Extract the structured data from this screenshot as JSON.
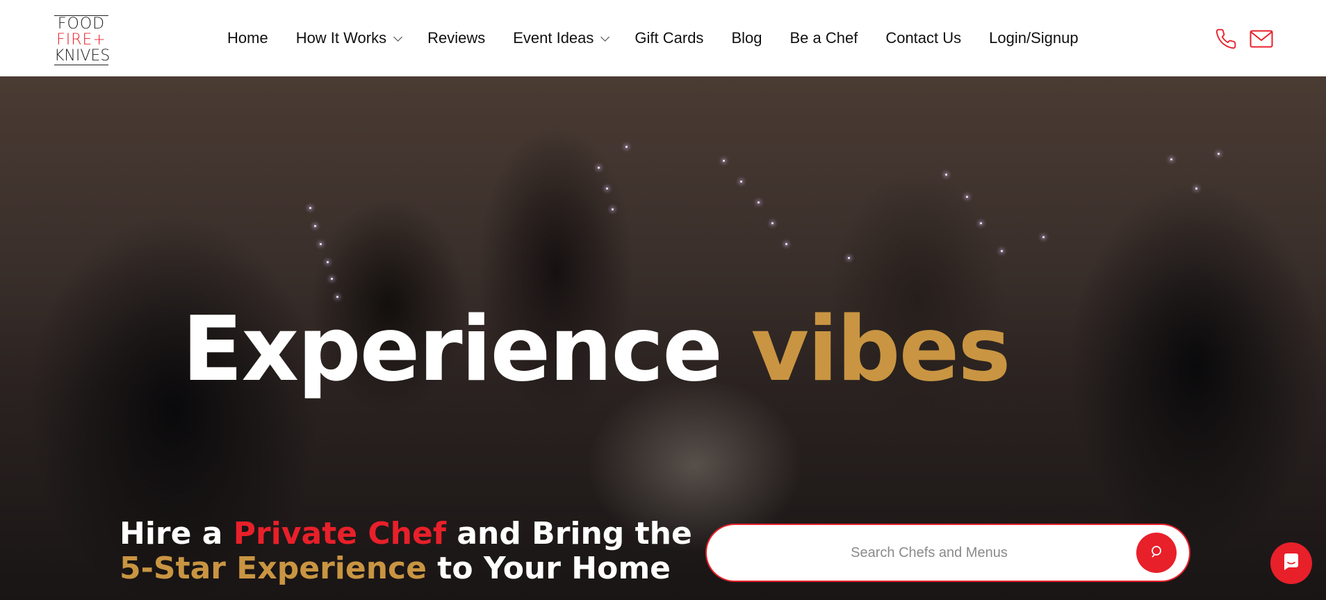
{
  "brand": {
    "logo_line1": "FOOD",
    "logo_line2": "FIRE+",
    "logo_line3": "KNIVES",
    "red": "#e8202a",
    "gold": "#c99542"
  },
  "nav": {
    "items": [
      {
        "label": "Home",
        "has_dropdown": false
      },
      {
        "label": "How It Works",
        "has_dropdown": true
      },
      {
        "label": "Reviews",
        "has_dropdown": false
      },
      {
        "label": "Event Ideas",
        "has_dropdown": true
      },
      {
        "label": "Gift Cards",
        "has_dropdown": false
      },
      {
        "label": "Blog",
        "has_dropdown": false
      },
      {
        "label": "Be a Chef",
        "has_dropdown": false
      },
      {
        "label": "Contact Us",
        "has_dropdown": false
      },
      {
        "label": "Login/Signup",
        "has_dropdown": false
      }
    ],
    "icons": [
      "phone-icon",
      "mail-icon"
    ]
  },
  "hero": {
    "headline_part1": "Experience",
    "headline_part2": "vibes",
    "tagline_line1_a": "Hire a",
    "tagline_line1_b": "Private Chef",
    "tagline_line1_c": "and Bring the",
    "tagline_line2_a": "5-Star Experience",
    "tagline_line2_b": "to Your Home"
  },
  "search": {
    "placeholder": "Search Chefs and Menus",
    "value": "",
    "icon": "search-icon"
  },
  "chat": {
    "icon": "chat-icon"
  }
}
